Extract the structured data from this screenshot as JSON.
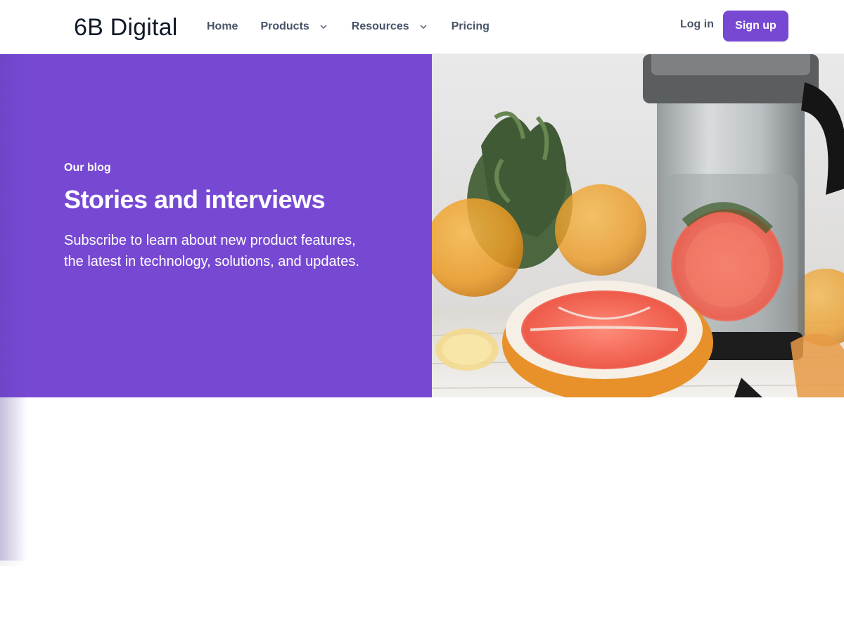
{
  "brand": {
    "name": "6B Digital",
    "accent": "#7749d3"
  },
  "nav": {
    "home": "Home",
    "products": "Products",
    "resources": "Resources",
    "pricing": "Pricing",
    "chevron_icon": "chevron-down-icon"
  },
  "auth": {
    "login": "Log in",
    "signup": "Sign up"
  },
  "hero": {
    "eyebrow": "Our blog",
    "title": "Stories and interviews",
    "subtitle": "Subscribe to learn about new product features, the latest in technology, solutions, and updates.",
    "background": "#7749d3",
    "image": "photo of grapefruit, oranges and mint with a glass infuser pitcher"
  }
}
